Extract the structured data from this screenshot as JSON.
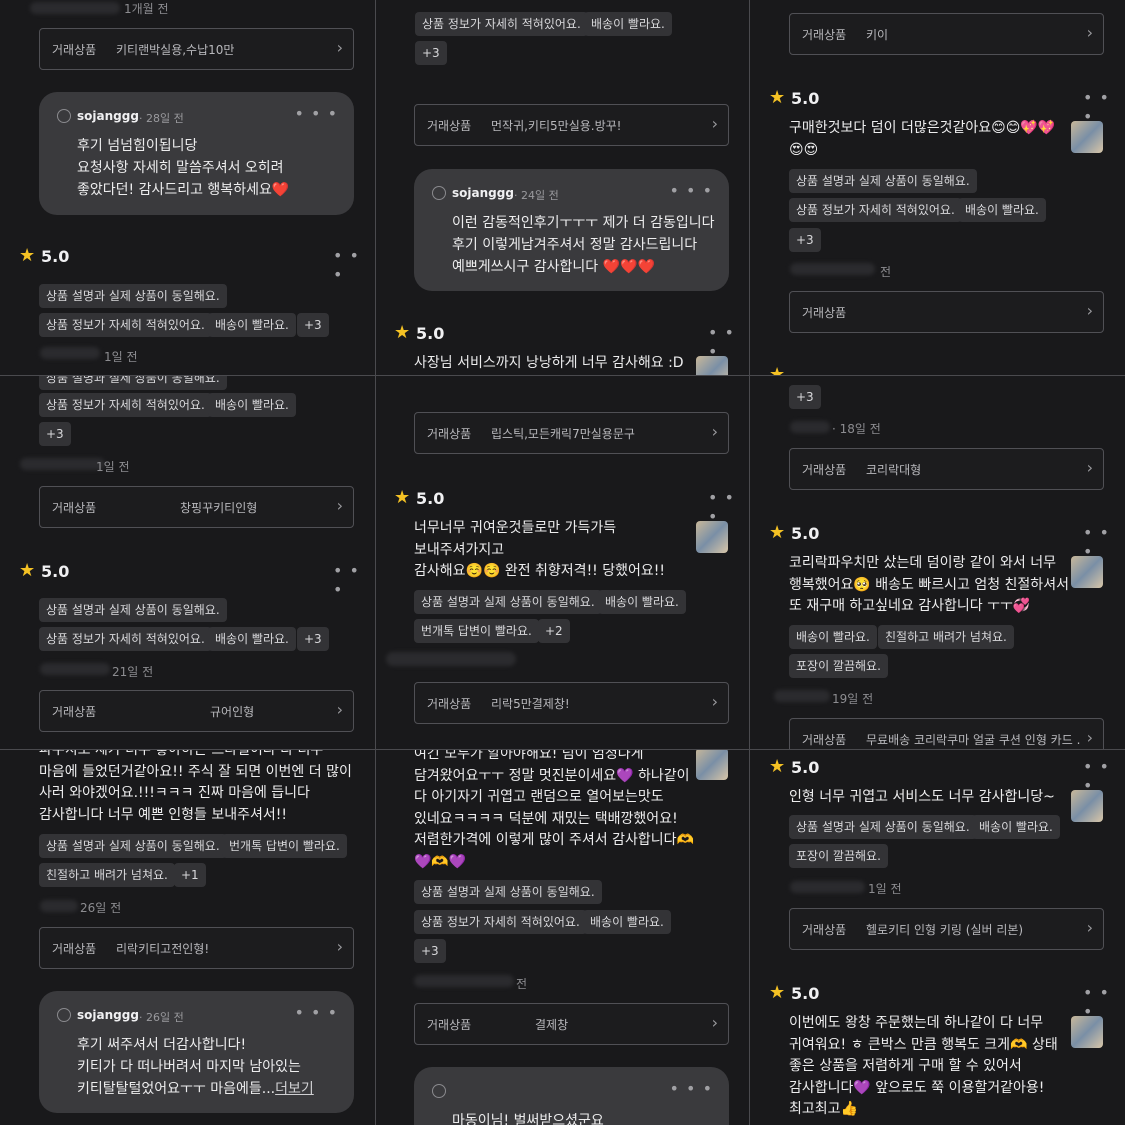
{
  "labels": {
    "product_label": "거래상품",
    "seller_name": "sojanggg",
    "plus3": "+3",
    "plus2": "+2",
    "plus1": "+1"
  },
  "tags": {
    "same_desc": "상품 설명과 실제 상품이 동일해요.",
    "detailed": "상품 정보가 자세히 적혀있어요.",
    "fast_ship": "배송이 빨라요.",
    "fast_reply": "번개톡 답변이 빨라요.",
    "kind": "친절하고 배려가 넘쳐요.",
    "clean_pack": "포장이 깔끔해요."
  },
  "panels": {
    "p1": {
      "date_top": "1개월 전",
      "product1": "키티랜박실용,수납10만",
      "reply_date": "· 28일 전",
      "reply_text": "후기 넘넘힘이됩니당\n요청사항 자세히 말씀주셔서 오히려\n좋았다던! 감사드리고 행복하세요❤️",
      "score": "5.0",
      "date_bottom": "1일 전"
    },
    "p2": {
      "tag_a": "상품 정보가 자세히 적혀있어요.",
      "product": "먼작귀,키티5만실용.방꾸!",
      "reply_date": "· 24일 전",
      "reply_text": "이런 감동적인후기ㅜㅜㅜ 제가 더 감동입니다\n후기 이렇게남겨주셔서 정말 감사드립니다\n예쁘게쓰시구 감사합니다 ❤️❤️❤️",
      "score": "5.0",
      "review": "사장님 서비스까지 낭낭하게 너무 감사해요 :D"
    },
    "p3": {
      "product1": "키이",
      "score": "5.0",
      "review": "구매한것보다 덤이 더많은것같아요😊😊💖💖\n😍😍",
      "date": "전",
      "product2": ""
    },
    "p4": {
      "date1": "1일 전",
      "product1": "창핑꾸키티인형",
      "score": "5.0",
      "date2": "21일 전",
      "product2": "규어인형"
    },
    "p5": {
      "product1": "립스틱,모든캐릭7만실용문구",
      "score": "5.0",
      "review": "너무너무 귀여운것들로만 가득가득\n보내주셔가지고\n감사해요☺️☺️ 완전 취향저격!! 당했어요!!",
      "product2": "리락5만결제창!"
    },
    "p6": {
      "date1": "· 18일 전",
      "product1": "코리락대형",
      "score": "5.0",
      "review": "코리락파우치만 샀는데 덤이랑 같이 와서 너무\n행복했어요🥺 배송도 빠르시고 엄청 친절하셔서\n또 재구매 하고싶네요 감사합니다 ㅜㅜ💞",
      "date2": "19일 전",
      "product2": "무료배송 코리락쿠마 얼굴 쿠션 인형 카드 ..."
    },
    "p7": {
      "review": "파우치도 제가 너무 좋아하는 스타일이라 다 너무\n마음에 들었던거같아요!! 주식 잘 되면 이번엔 더 많이\n사러 와야겠어요.!!!ㅋㅋㅋ 진짜 마음에 듭니다\n감사합니다 너무 예쁜 인형들 보내주셔서!!",
      "date": "26일 전",
      "product": "리락키티고전인형!",
      "reply_date": "· 26일 전",
      "reply_text": "후기 써주셔서 더감사합니다!\n키티가 다 떠나버려서 마지막 남아있는\n키티탈탈털었어요ㅜㅜ 마음에들...",
      "more": "더보기"
    },
    "p8": {
      "review": "여긴 모두가 알아야해요! 덤이 엄청나게\n담겨왔어요ㅜㅜ 정말 멋진분이세요💜 하나같이\n다 아기자기 귀엽고 랜덤으로 열어보는맛도\n있네요ㅋㅋㅋㅋ 덕분에 재밌는 택배깡했어요!\n저렴한가격에 이렇게 많이 주셔서 감사합니다🫶\n💜🫶💜",
      "date": "전",
      "product": "결제창",
      "reply_text": "마동이님! 벌써받으셨군요"
    },
    "p9": {
      "score1": "5.0",
      "review1": "인형 너무 귀엽고 서비스도 너무 감사합니당~",
      "date": "1일 전",
      "product": "헬로키티 인형 키링 (실버 리본)",
      "score2": "5.0",
      "review2": "이번에도 왕창 주문했는데 하나같이 다 너무\n귀여워요! ㅎ 큰박스 만큼 행복도 크게🫶 상태\n좋은 상품을 저렴하게 구매 할 수 있어서\n감사합니다💜 앞으로도 쭉 이용할거같아용!\n최고최고👍"
    }
  },
  "icons": {
    "star": "star-icon",
    "chevron": "chevron-right-icon",
    "more": "more-dots-icon",
    "seller": "seller-avatar-icon"
  },
  "colors": {
    "background": "#19191b",
    "star": "#f5c224",
    "tag_bg": "#333336",
    "reply_bg": "#3a3a3d",
    "divider": "#4a4a4e"
  }
}
